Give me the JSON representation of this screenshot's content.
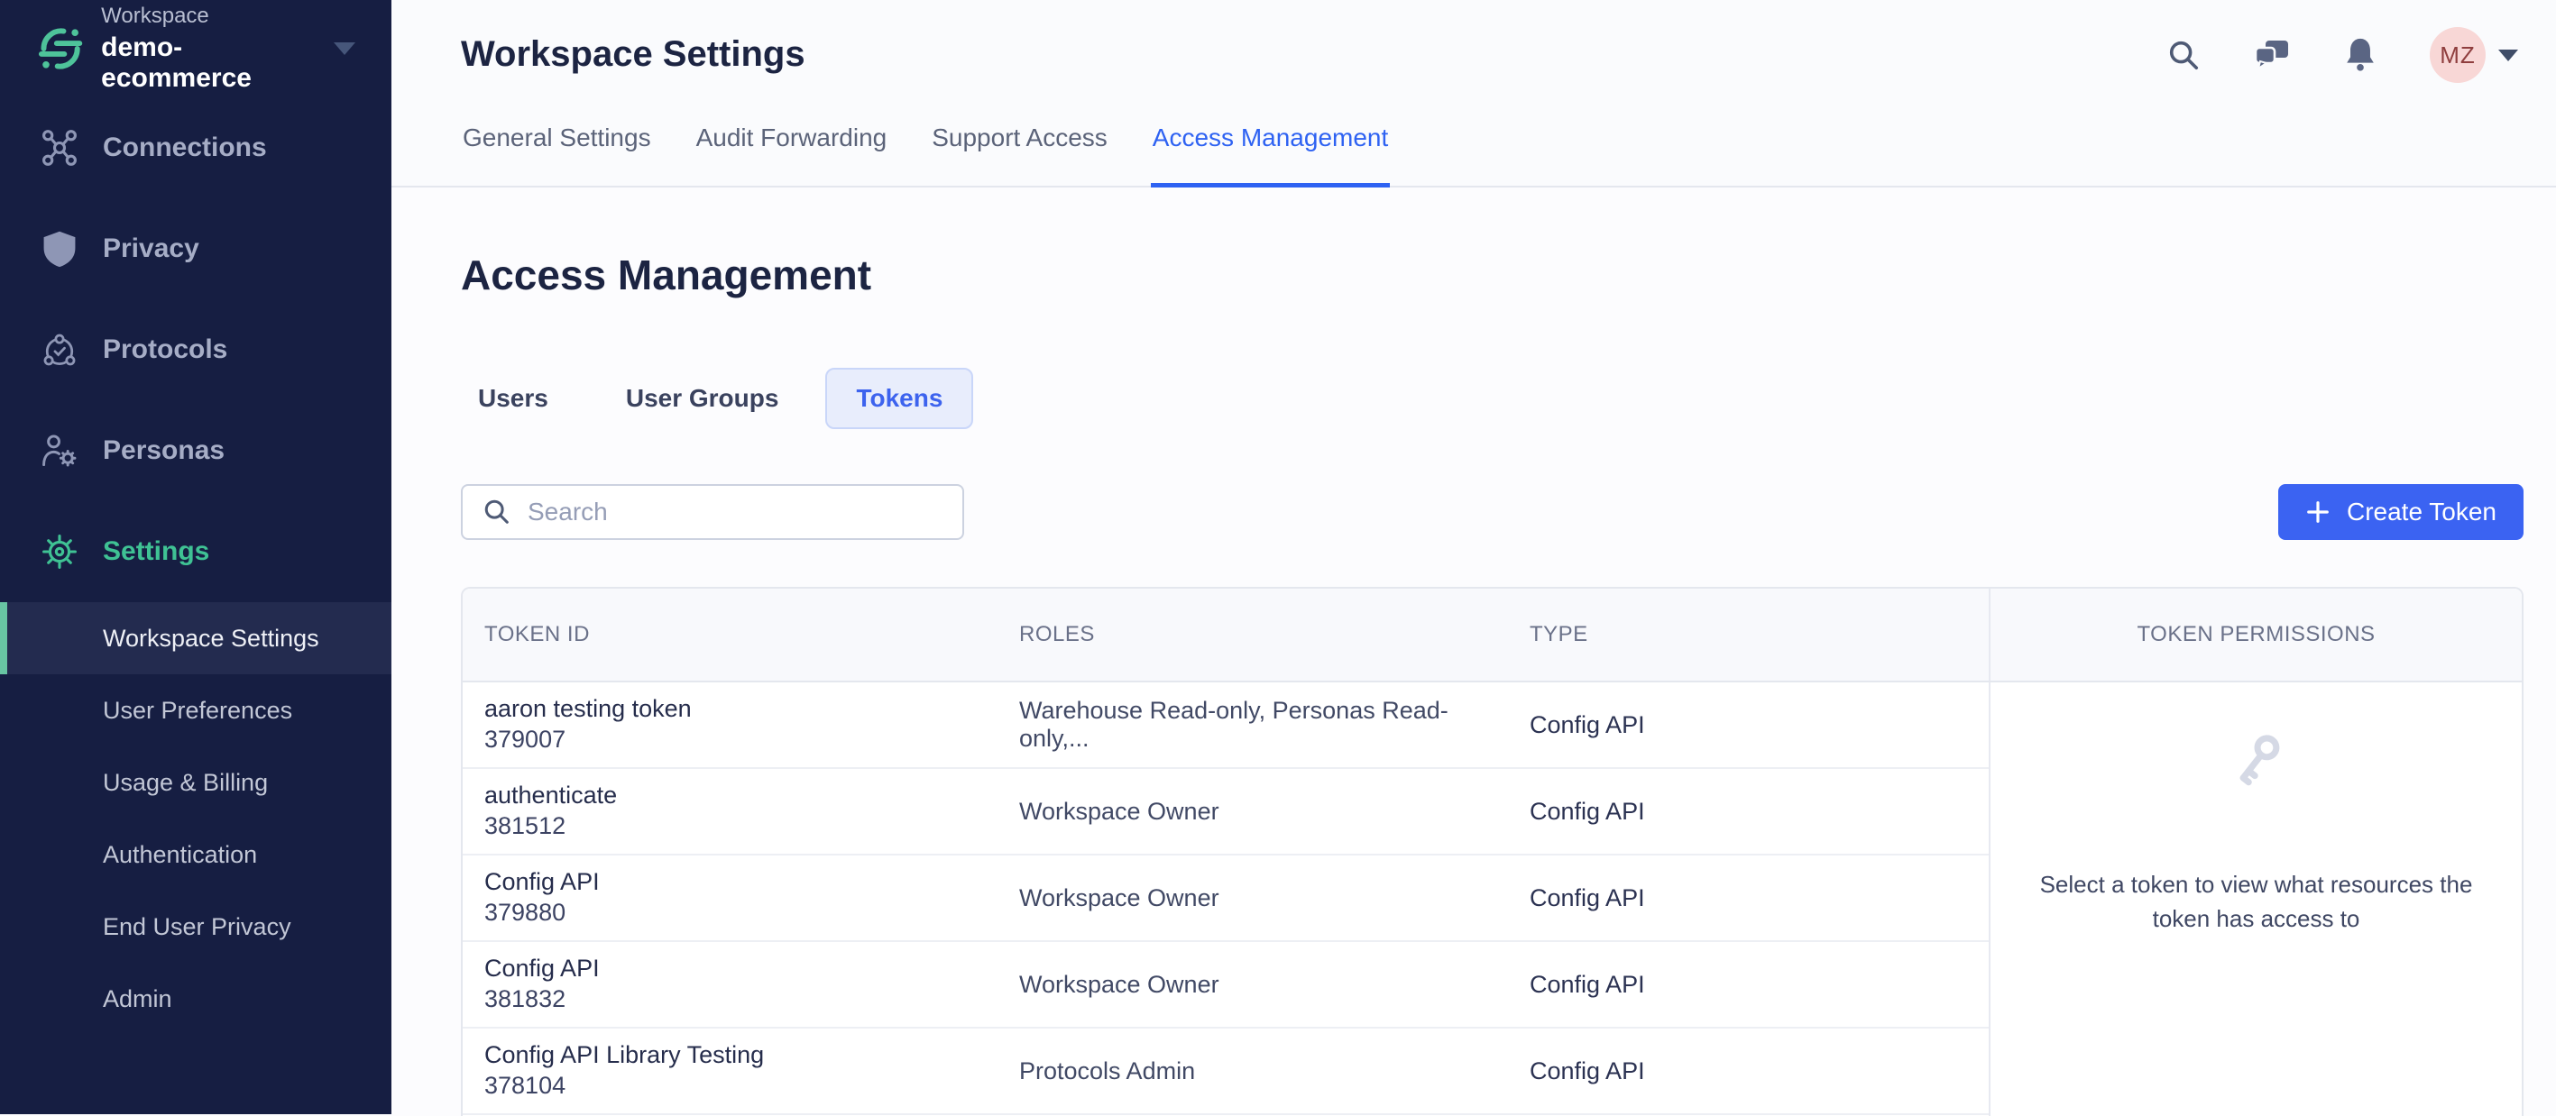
{
  "colors": {
    "brand_green": "#4EC39A",
    "accent_blue": "#2E62F2",
    "button_blue": "#3B63F2",
    "sidebar_navy": "#161E42",
    "active_subitem_bg": "#232B4F",
    "avatar_bg": "#F8D7D6",
    "avatar_text": "#8F3E3E"
  },
  "sidebar": {
    "workspace_label": "Workspace",
    "workspace_name": "demo-ecommerce",
    "items": [
      {
        "label": "Connections"
      },
      {
        "label": "Privacy"
      },
      {
        "label": "Protocols"
      },
      {
        "label": "Personas"
      },
      {
        "label": "Settings"
      }
    ],
    "subitems": [
      {
        "label": "Workspace Settings"
      },
      {
        "label": "User Preferences"
      },
      {
        "label": "Usage & Billing"
      },
      {
        "label": "Authentication"
      },
      {
        "label": "End User Privacy"
      },
      {
        "label": "Admin"
      }
    ]
  },
  "topbar": {
    "title": "Workspace Settings",
    "tabs": [
      {
        "label": "General Settings"
      },
      {
        "label": "Audit Forwarding"
      },
      {
        "label": "Support Access"
      },
      {
        "label": "Access Management"
      }
    ],
    "avatar_initials": "MZ"
  },
  "main": {
    "title": "Access Management",
    "tabs": [
      {
        "label": "Users"
      },
      {
        "label": "User Groups"
      },
      {
        "label": "Tokens"
      }
    ],
    "search_placeholder": "Search",
    "create_token_label": "Create Token",
    "table": {
      "columns": [
        "TOKEN ID",
        "ROLES",
        "TYPE"
      ],
      "rows": [
        {
          "name": "aaron testing token",
          "id": "379007",
          "roles": "Warehouse Read-only, Personas Read-only,...",
          "type": "Config API"
        },
        {
          "name": "authenticate",
          "id": "381512",
          "roles": "Workspace Owner",
          "type": "Config API"
        },
        {
          "name": "Config API",
          "id": "379880",
          "roles": "Workspace Owner",
          "type": "Config API"
        },
        {
          "name": "Config API",
          "id": "381832",
          "roles": "Workspace Owner",
          "type": "Config API"
        },
        {
          "name": "Config API Library Testing",
          "id": "378104",
          "roles": "Protocols Admin",
          "type": "Config API"
        }
      ]
    },
    "permissions": {
      "title": "TOKEN PERMISSIONS",
      "empty_text": "Select a token to view what resources the token has access to"
    }
  }
}
